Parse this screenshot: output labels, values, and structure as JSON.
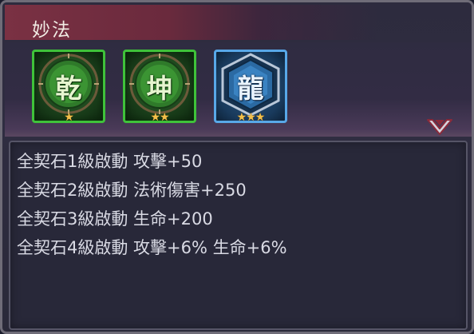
{
  "panel": {
    "title": "妙法"
  },
  "gems": [
    {
      "glyph": "乾",
      "stars": "★",
      "star_count": 1,
      "color": "green"
    },
    {
      "glyph": "坤",
      "stars": "★★",
      "star_count": 2,
      "color": "green"
    },
    {
      "glyph": "龍",
      "stars": "★★★",
      "star_count": 3,
      "color": "blue"
    }
  ],
  "expand_icon": "chevron-down-icon",
  "description": {
    "lines": [
      "全契石1級啟動 攻擊+50",
      "全契石2級啟動 法術傷害+250",
      "全契石3級啟動 生命+200",
      "全契石4級啟動 攻擊+6% 生命+6%"
    ]
  },
  "colors": {
    "title_bar": "#7a3143",
    "green_frame": "#3fc23a",
    "blue_frame": "#58a8e8",
    "star": "#f3c04a",
    "text": "#d9dae4"
  }
}
